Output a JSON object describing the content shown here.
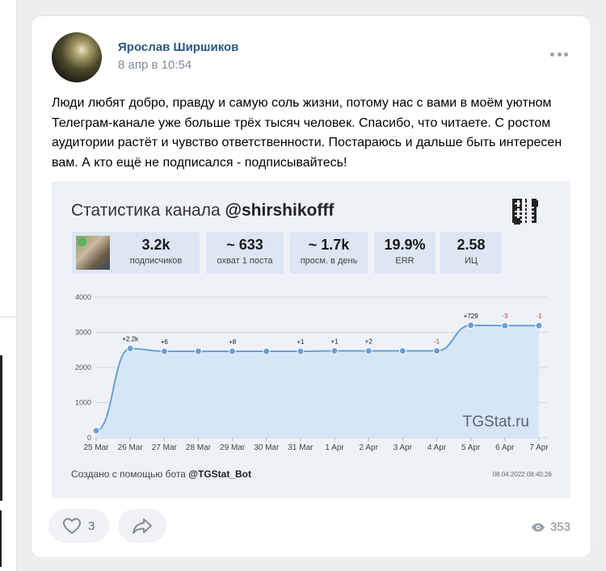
{
  "post": {
    "author": "Ярослав Ширшиков",
    "date": "8 апр в 10:54",
    "text": "Люди любят добро, правду и самую соль жизни, потому нас с вами в моём уютном Телеграм-канале уже больше трёх тысяч человек. Спасибо, что читаете. С ростом аудитории растёт и чувство ответственности. Постараюсь и дальше быть интересен вам. А кто ещё не подписался - подписывайтесь!"
  },
  "image": {
    "title_prefix": "Статистика канала ",
    "title_handle": "@shirshikofff",
    "stats": [
      {
        "value": "3.2k",
        "label": "подписчиков"
      },
      {
        "value": "~ 633",
        "label": "охват 1 поста"
      },
      {
        "value": "~ 1.7k",
        "label": "просм. в день"
      },
      {
        "value": "19.9%",
        "label": "ERR"
      },
      {
        "value": "2.58",
        "label": "ИЦ"
      }
    ],
    "footer_prefix": "Создано с помощью бота ",
    "footer_bot": "@TGStat_Bot",
    "timestamp": "08.04.2022 08:40:26"
  },
  "chart_data": {
    "type": "area",
    "categories": [
      "25 Mar",
      "26 Mar",
      "27 Mar",
      "28 Mar",
      "29 Mar",
      "30 Mar",
      "31 Mar",
      "1 Apr",
      "2 Apr",
      "3 Apr",
      "4 Apr",
      "5 Apr",
      "6 Apr",
      "7 Apr"
    ],
    "values": [
      200,
      2540,
      2460,
      2460,
      2460,
      2460,
      2460,
      2470,
      2470,
      2470,
      2470,
      3200,
      3190,
      3190
    ],
    "labels": [
      "",
      "+2.2k",
      "+6",
      "",
      "+8",
      "",
      "+1",
      "+1",
      "+2",
      "",
      "-1",
      "+729",
      "-3",
      "-1"
    ],
    "yticks": [
      0,
      1000,
      2000,
      3000,
      4000
    ],
    "ylim": [
      0,
      4000
    ],
    "watermark": "TGStat.ru",
    "colors": {
      "line": "#6a9fd6",
      "fill": "#d7e6f7",
      "point": "#6a9fd6",
      "label_pos": "#1a1a1a",
      "label_neg": "#c0392b"
    }
  },
  "actions": {
    "like_count": "3",
    "views_count": "353"
  }
}
